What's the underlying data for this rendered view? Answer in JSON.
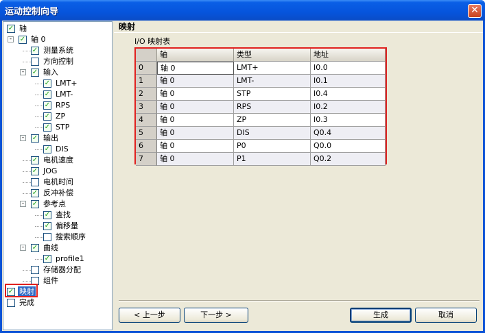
{
  "window": {
    "title": "运动控制向导",
    "close_label": "✕"
  },
  "tree": [
    {
      "label": "轴",
      "checked": true,
      "level": 0,
      "expander": null,
      "selected": false
    },
    {
      "label": "轴 0",
      "checked": true,
      "level": 1,
      "expander": "-",
      "selected": false
    },
    {
      "label": "测量系统",
      "checked": true,
      "level": 2,
      "expander": null,
      "selected": false
    },
    {
      "label": "方向控制",
      "checked": false,
      "level": 2,
      "expander": null,
      "selected": false
    },
    {
      "label": "输入",
      "checked": true,
      "level": 2,
      "expander": "-",
      "selected": false
    },
    {
      "label": "LMT+",
      "checked": true,
      "level": 3,
      "expander": null,
      "selected": false
    },
    {
      "label": "LMT-",
      "checked": true,
      "level": 3,
      "expander": null,
      "selected": false
    },
    {
      "label": "RPS",
      "checked": true,
      "level": 3,
      "expander": null,
      "selected": false
    },
    {
      "label": "ZP",
      "checked": true,
      "level": 3,
      "expander": null,
      "selected": false
    },
    {
      "label": "STP",
      "checked": true,
      "level": 3,
      "expander": null,
      "selected": false
    },
    {
      "label": "输出",
      "checked": true,
      "level": 2,
      "expander": "-",
      "selected": false
    },
    {
      "label": "DIS",
      "checked": true,
      "level": 3,
      "expander": null,
      "selected": false
    },
    {
      "label": "电机速度",
      "checked": true,
      "level": 2,
      "expander": null,
      "selected": false
    },
    {
      "label": "JOG",
      "checked": true,
      "level": 2,
      "expander": null,
      "selected": false
    },
    {
      "label": "电机时间",
      "checked": false,
      "level": 2,
      "expander": null,
      "selected": false
    },
    {
      "label": "反冲补偿",
      "checked": true,
      "level": 2,
      "expander": null,
      "selected": false
    },
    {
      "label": "参考点",
      "checked": true,
      "level": 2,
      "expander": "-",
      "selected": false
    },
    {
      "label": "查找",
      "checked": true,
      "level": 3,
      "expander": null,
      "selected": false
    },
    {
      "label": "偏移量",
      "checked": true,
      "level": 3,
      "expander": null,
      "selected": false
    },
    {
      "label": "搜索顺序",
      "checked": false,
      "level": 3,
      "expander": null,
      "selected": false
    },
    {
      "label": "曲线",
      "checked": true,
      "level": 2,
      "expander": "-",
      "selected": false
    },
    {
      "label": "profile1",
      "checked": true,
      "level": 3,
      "expander": null,
      "selected": false
    },
    {
      "label": "存储器分配",
      "checked": false,
      "level": 2,
      "expander": null,
      "selected": false
    },
    {
      "label": "组件",
      "checked": false,
      "level": 2,
      "expander": null,
      "selected": false
    },
    {
      "label": "映射",
      "checked": true,
      "level": 0,
      "expander": null,
      "selected": true
    },
    {
      "label": "完成",
      "checked": false,
      "level": 0,
      "expander": null,
      "selected": false
    }
  ],
  "main": {
    "title": "映射",
    "table_caption": "I/O 映射表",
    "columns": [
      "轴",
      "类型",
      "地址"
    ],
    "rows": [
      {
        "idx": "0",
        "axis": "轴 0",
        "type": "LMT+",
        "addr": "I0.0"
      },
      {
        "idx": "1",
        "axis": "轴 0",
        "type": "LMT-",
        "addr": "I0.1"
      },
      {
        "idx": "2",
        "axis": "轴 0",
        "type": "STP",
        "addr": "I0.4"
      },
      {
        "idx": "3",
        "axis": "轴 0",
        "type": "RPS",
        "addr": "I0.2"
      },
      {
        "idx": "4",
        "axis": "轴 0",
        "type": "ZP",
        "addr": "I0.3"
      },
      {
        "idx": "5",
        "axis": "轴 0",
        "type": "DIS",
        "addr": "Q0.4"
      },
      {
        "idx": "6",
        "axis": "轴 0",
        "type": "P0",
        "addr": "Q0.0"
      },
      {
        "idx": "7",
        "axis": "轴 0",
        "type": "P1",
        "addr": "Q0.2"
      }
    ]
  },
  "buttons": {
    "prev": "< 上一步",
    "next": "下一步 >",
    "generate": "生成",
    "cancel": "取消"
  }
}
